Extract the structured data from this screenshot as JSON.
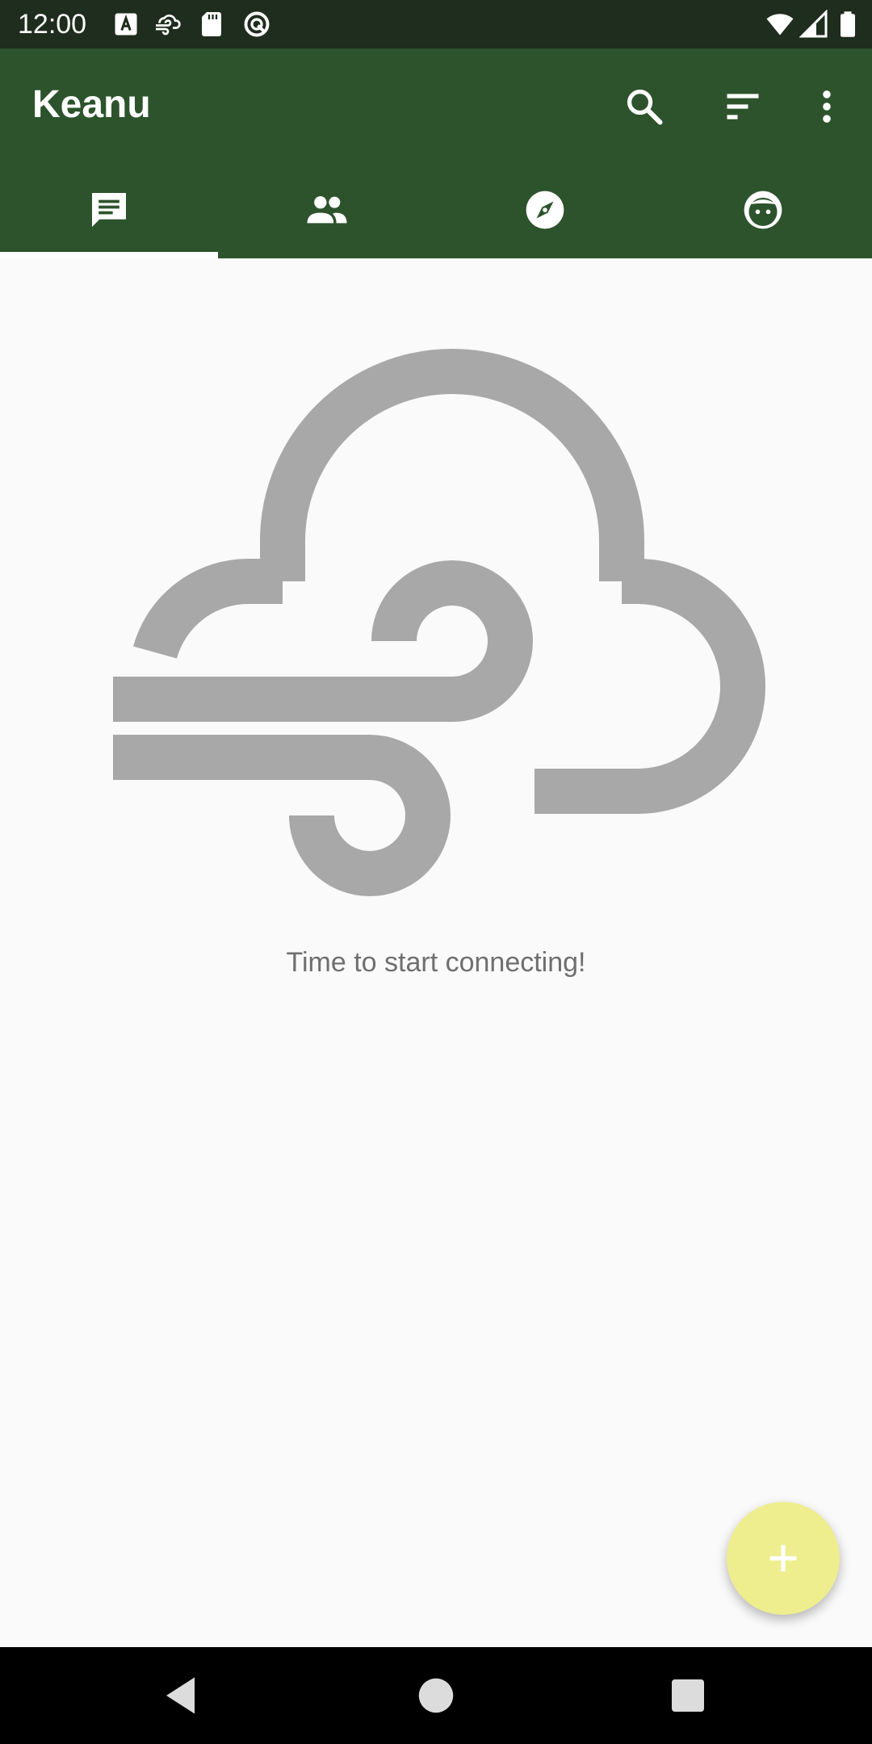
{
  "status_bar": {
    "time": "12:00",
    "left_icons": [
      "font-a-icon",
      "cloud-wind-icon",
      "sd-card-icon",
      "blocked-circle-icon"
    ],
    "right_icons": [
      "wifi-icon",
      "cellular-signal-icon",
      "battery-icon"
    ]
  },
  "app_bar": {
    "title": "Keanu",
    "actions": [
      "search-icon",
      "sort-icon",
      "more-vert-icon"
    ]
  },
  "tabs": [
    {
      "icon": "chat-icon",
      "selected": true
    },
    {
      "icon": "people-icon",
      "selected": false
    },
    {
      "icon": "compass-icon",
      "selected": false
    },
    {
      "icon": "face-icon",
      "selected": false
    }
  ],
  "empty_state": {
    "icon": "windy-cloud-icon",
    "message": "Time to start connecting!"
  },
  "fab": {
    "icon": "plus-icon"
  },
  "nav_bar": {
    "buttons": [
      "back-icon",
      "home-icon",
      "recents-icon"
    ]
  },
  "colors": {
    "status_bar": "#1e2d1d",
    "app_bar": "#2d532c",
    "background": "#fafafa",
    "fab": "#eeee8f",
    "illustration": "#a8a8a8",
    "message_text": "#6f6f6f"
  }
}
